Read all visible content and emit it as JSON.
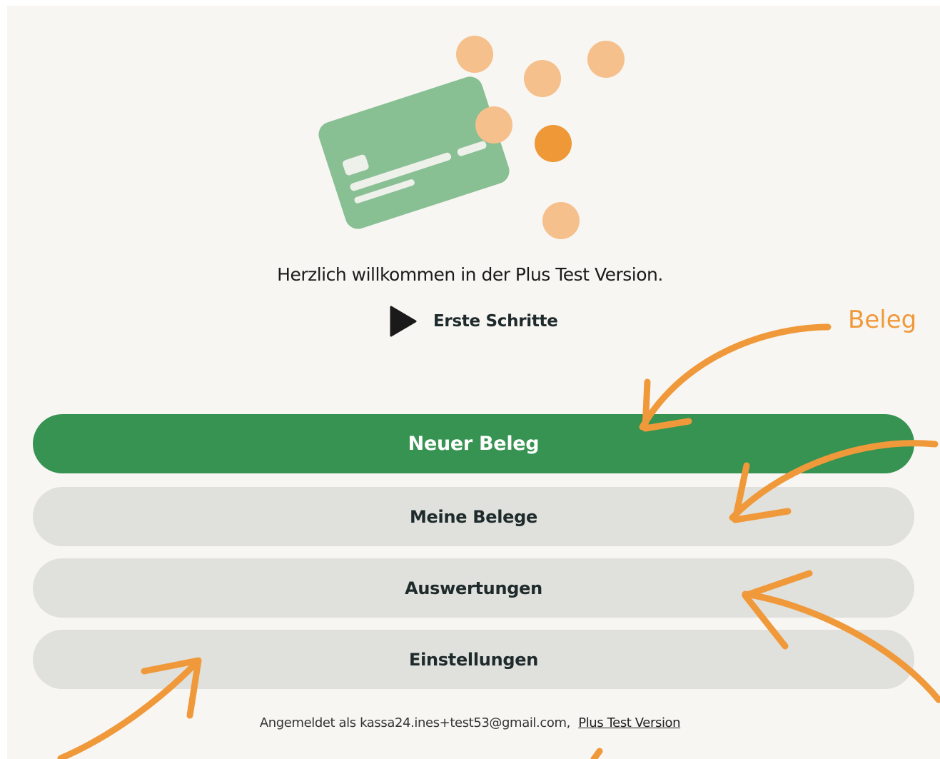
{
  "welcome_text": "Herzlich willkommen in der Plus Test Version.",
  "first_steps": {
    "label": "Erste Schritte",
    "icon": "play-icon"
  },
  "menu": {
    "new_receipt": "Neuer Beleg",
    "my_receipts": "Meine Belege",
    "reports": "Auswertungen",
    "settings": "Einstellungen"
  },
  "footer": {
    "logged_in_text": "Angemeldet als kassa24.ines+test53@gmail.com,",
    "version_link": "Plus Test Version"
  },
  "annotation": {
    "label": "Beleg"
  },
  "colors": {
    "primary": "#369351",
    "secondary_button": "#e0e1dc",
    "annotation": "#f0993b",
    "background": "#f8f6f2"
  }
}
